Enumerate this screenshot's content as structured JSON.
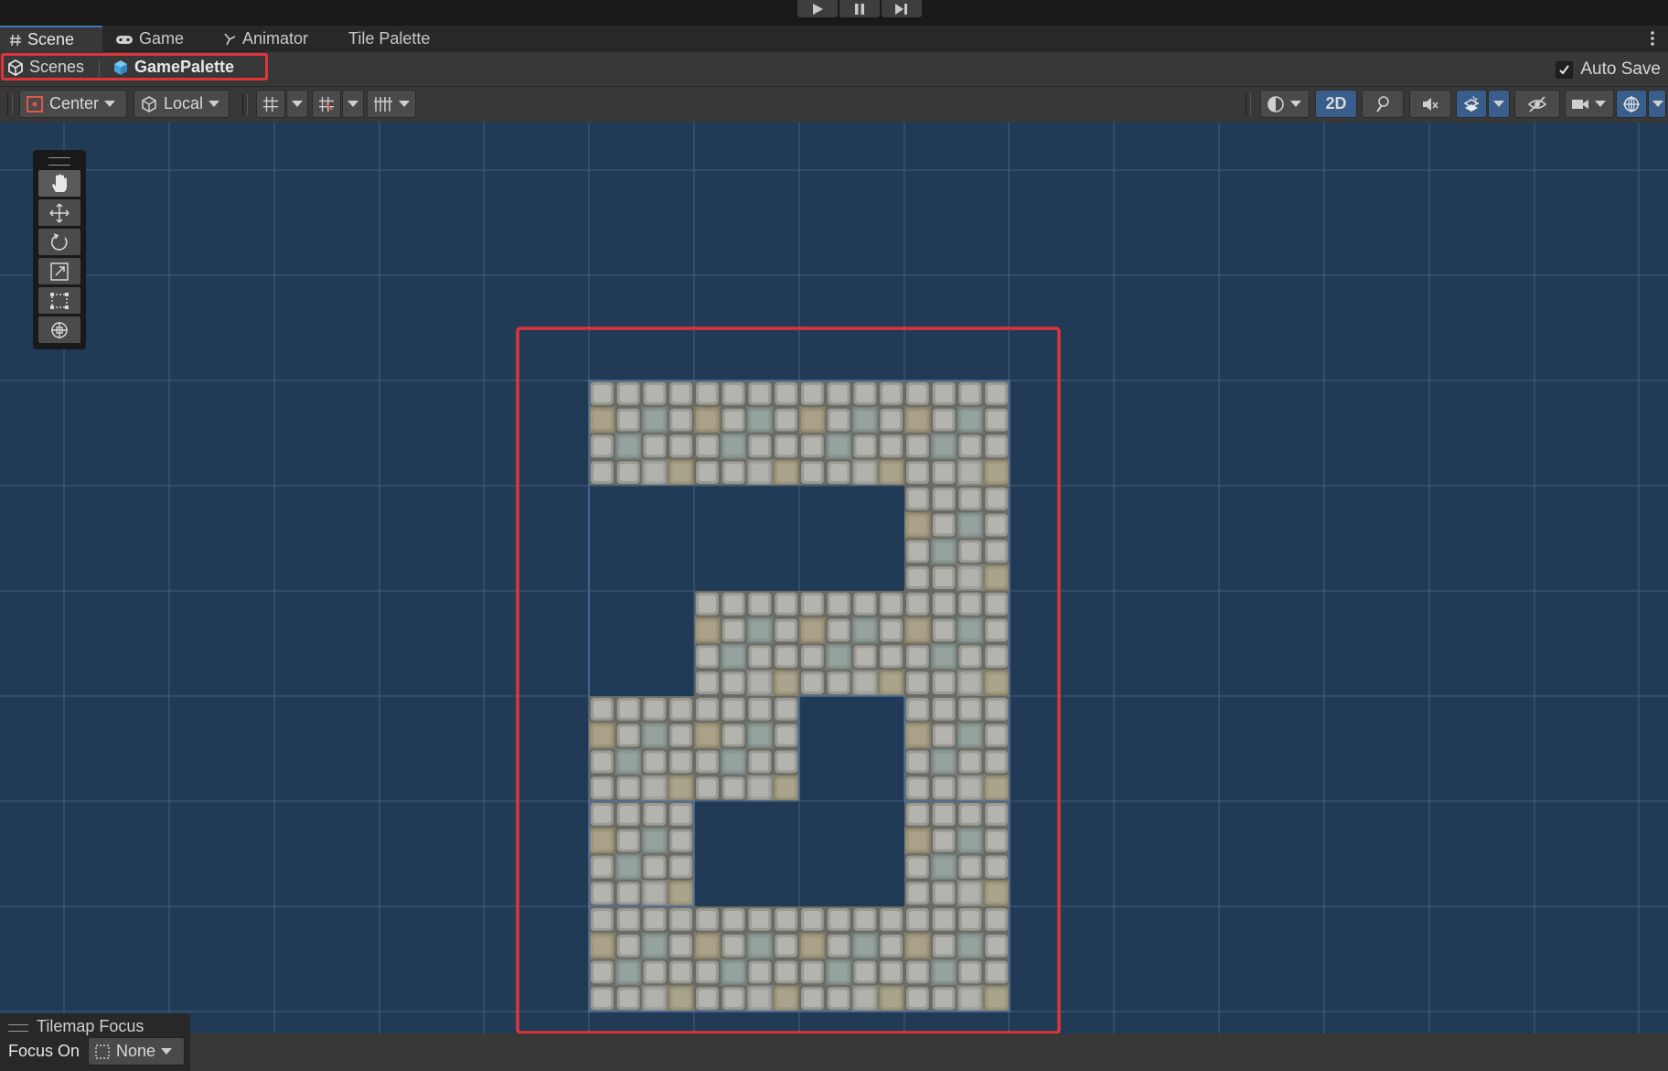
{
  "playbar": {
    "buttons": [
      {
        "name": "play-button",
        "icon": "play-icon"
      },
      {
        "name": "pause-button",
        "icon": "pause-icon"
      },
      {
        "name": "step-button",
        "icon": "step-icon"
      }
    ]
  },
  "tabs": [
    {
      "label": "Scene",
      "icon": "hash-icon",
      "active": true
    },
    {
      "label": "Game",
      "icon": "gamepad-icon",
      "active": false
    },
    {
      "label": "Animator",
      "icon": "animator-icon",
      "active": false
    },
    {
      "label": "Tile Palette",
      "icon": "",
      "active": false
    }
  ],
  "breadcrumb": {
    "root": "Scenes",
    "current": "GamePalette"
  },
  "auto_save": {
    "label": "Auto Save",
    "checked": true
  },
  "toolbar": {
    "pivot": "Center",
    "space": "Local",
    "mode_2d": "2D"
  },
  "tilemap_focus": {
    "title": "Tilemap Focus",
    "focus_label": "Focus On",
    "focus_value": "None"
  },
  "colors": {
    "scene_bg": "#213a56",
    "grid_line": "#3e5876",
    "highlight": "#e0343a",
    "accent": "#3a79bb"
  }
}
